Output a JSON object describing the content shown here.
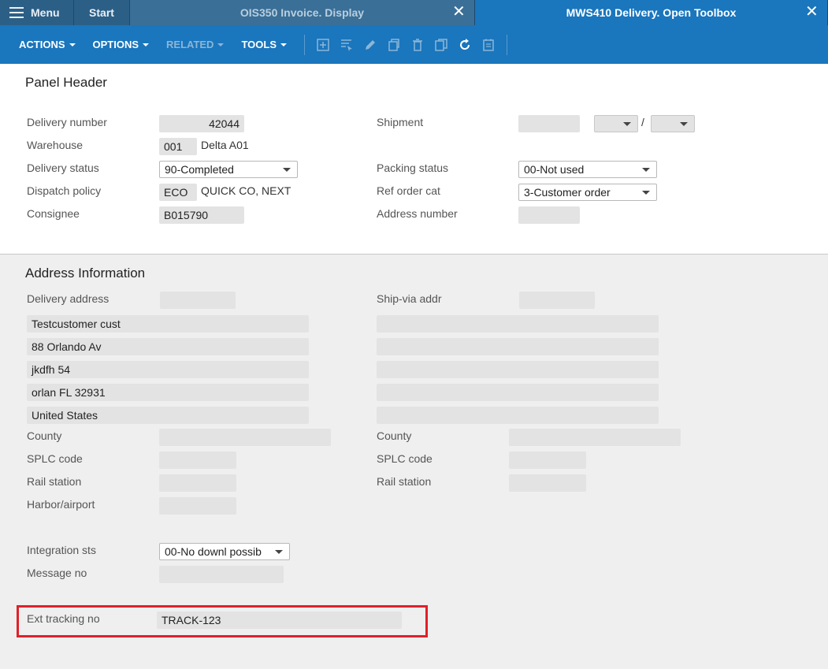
{
  "tabs": {
    "menu_label": "Menu",
    "start_label": "Start",
    "tab1_label": "OIS350 Invoice. Display",
    "tab2_label": "MWS410 Delivery. Open Toolbox",
    "close_glyph": "✕"
  },
  "toolbar": {
    "actions": "ACTIONS",
    "options": "OPTIONS",
    "related": "RELATED",
    "tools": "TOOLS",
    "icons": [
      "add-icon",
      "select-icon",
      "edit-icon",
      "copy-icon",
      "delete-icon",
      "duplicate-icon",
      "refresh-icon",
      "notes-icon"
    ]
  },
  "header": {
    "title": "Panel Header",
    "delivery_number_label": "Delivery number",
    "delivery_number": "42044",
    "warehouse_label": "Warehouse",
    "warehouse_code": "001",
    "warehouse_name": "Delta A01",
    "delivery_status_label": "Delivery status",
    "delivery_status": "90-Completed",
    "dispatch_policy_label": "Dispatch policy",
    "dispatch_policy_code": "ECO",
    "dispatch_policy_name": "QUICK CO, NEXT",
    "consignee_label": "Consignee",
    "consignee": "B015790",
    "shipment_label": "Shipment",
    "shipment_separator": "/",
    "packing_status_label": "Packing status",
    "packing_status": "00-Not used",
    "ref_order_cat_label": "Ref order cat",
    "ref_order_cat": "3-Customer order",
    "address_number_label": "Address number"
  },
  "address": {
    "title": "Address Information",
    "delivery_address_label": "Delivery address",
    "ship_via_label": "Ship-via addr",
    "lines": [
      "Testcustomer cust",
      "88 Orlando Av",
      "jkdfh 54",
      "orlan FL 32931",
      "United States"
    ],
    "county_label": "County",
    "splc_label": "SPLC code",
    "rail_label": "Rail station",
    "harbor_label": "Harbor/airport",
    "integration_label": "Integration sts",
    "integration_value": "00-No downl possib",
    "message_label": "Message no",
    "ext_tracking_label": "Ext tracking no",
    "ext_tracking_value": "TRACK-123"
  },
  "colors": {
    "tab_bar": "#2c5f86",
    "toolbar": "#1a76bd",
    "highlight": "#e0202a"
  }
}
